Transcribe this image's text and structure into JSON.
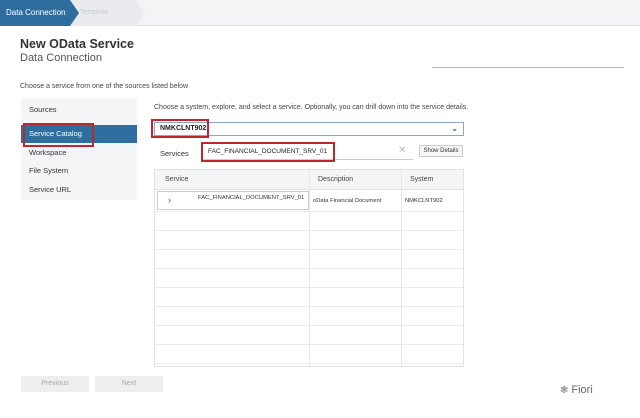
{
  "breadcrumb": {
    "steps": [
      "Data Connection",
      "Template"
    ]
  },
  "page": {
    "title": "New OData Service",
    "subtitle": "Data Connection",
    "intro": "Choose a service from one of the sources listed below"
  },
  "sources": {
    "header": "Sources",
    "items": [
      "Service Catalog",
      "Workspace",
      "File System",
      "Service URL"
    ],
    "selected_index": 0,
    "selected_color": "#2e6e9e"
  },
  "main": {
    "instruction": "Choose a system, explore, and select a service. Optionally, you can drill down into the service details.",
    "system_value": "NMKCLNT902",
    "services_label": "Services",
    "services_value": "FAC_FINANCIAL_DOCUMENT_SRV_01",
    "show_details_label": "Show Details"
  },
  "table": {
    "columns": [
      "Service",
      "Description",
      "System"
    ],
    "rows": [
      {
        "service": "FAC_FINANCIAL_DOCUMENT_SRV_01",
        "description": "oData Financial Document",
        "system": "NMKCLNT902"
      }
    ]
  },
  "footer": {
    "previous_label": "Previous",
    "next_label": "Next"
  },
  "watermark": {
    "text": "Fiori",
    "icon": "wechat-icon"
  },
  "highlight_color": "#c0272d"
}
